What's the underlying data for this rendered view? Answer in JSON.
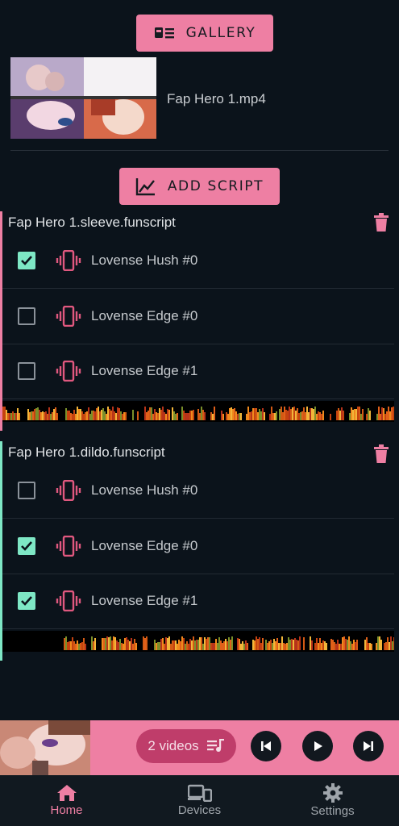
{
  "header": {
    "gallery_label": "GALLERY",
    "video_name": "Fap Hero 1.mp4",
    "add_script_label": "ADD SCRIPT"
  },
  "scripts": [
    {
      "name": "Fap Hero 1.sleeve.funscript",
      "accent": "#ee7fa3",
      "devices": [
        {
          "label": "Lovense Hush #0",
          "checked": true
        },
        {
          "label": "Lovense Edge #0",
          "checked": false
        },
        {
          "label": "Lovense Edge #1",
          "checked": false
        }
      ]
    },
    {
      "name": "Fap Hero 1.dildo.funscript",
      "accent": "#7ee7c5",
      "devices": [
        {
          "label": "Lovense Hush #0",
          "checked": false
        },
        {
          "label": "Lovense Edge #0",
          "checked": true
        },
        {
          "label": "Lovense Edge #1",
          "checked": true
        }
      ]
    }
  ],
  "player": {
    "videos_label": "2 videos"
  },
  "nav": {
    "home": "Home",
    "devices": "Devices",
    "settings": "Settings"
  },
  "colors": {
    "background": "#0b131b",
    "primary": "#ee7fa3",
    "secondary": "#7ee7c5",
    "vibrate_icon": "#e0587f"
  }
}
